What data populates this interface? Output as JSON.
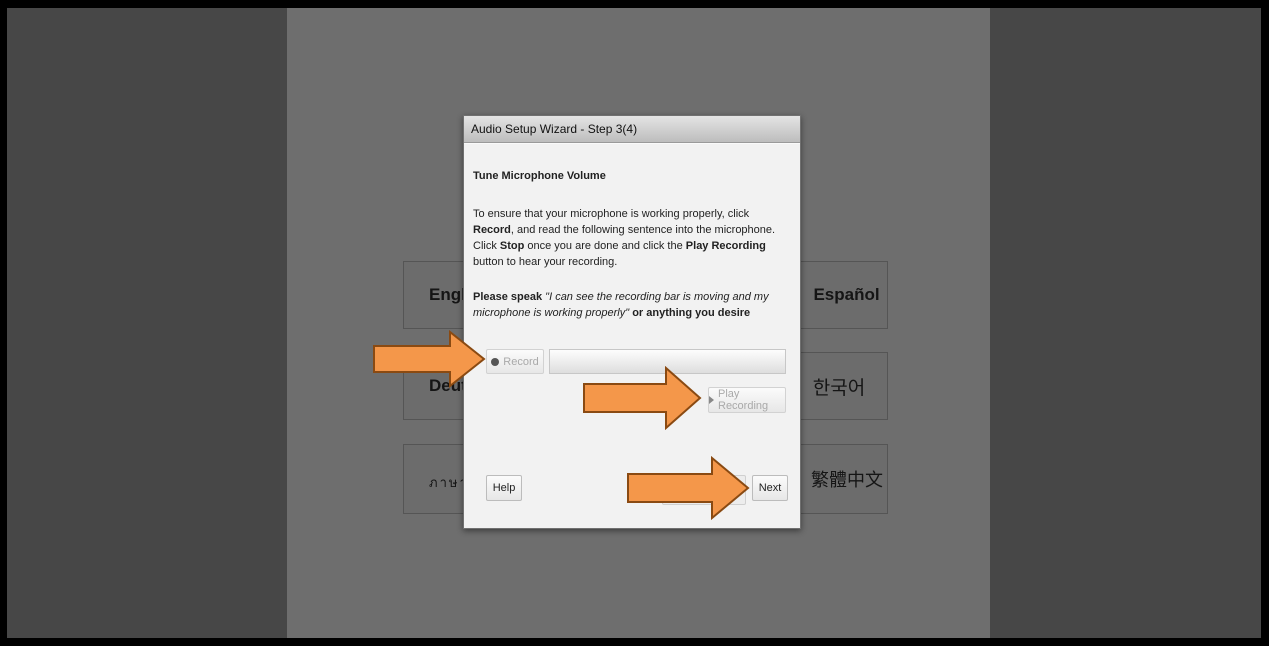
{
  "languages": {
    "english": "Engli",
    "espanol": "Español",
    "deutsch": "Deuts",
    "korean": "한국어",
    "thai": "ภาษาไ",
    "chinese_traditional": "繁體中文"
  },
  "dialog": {
    "title": "Audio Setup Wizard - Step 3(4)",
    "heading": "Tune Microphone Volume",
    "instructions": {
      "p1": "To ensure that your microphone is working properly, click ",
      "p1_b1": "Record",
      "p2": ", and read the following sentence into the microphone. Click ",
      "p2_b2": "Stop",
      "p3": " once you are done and click the ",
      "p3_b3": "Play Recording",
      "p4": " button to hear your recording."
    },
    "speak": {
      "lead": "Please speak ",
      "quote": "\"I can see the recording bar is moving and my microphone is working properly\"",
      "tail": " or anything you desire"
    },
    "record_label": "Record",
    "play_label": "Play Recording",
    "help_label": "Help",
    "next_label": "Next"
  },
  "colors": {
    "arrow_fill": "#f4974a",
    "arrow_stroke": "#8a4a12"
  },
  "icons": [
    "record-dot-icon",
    "play-triangle-icon",
    "arrow-right-icon"
  ]
}
